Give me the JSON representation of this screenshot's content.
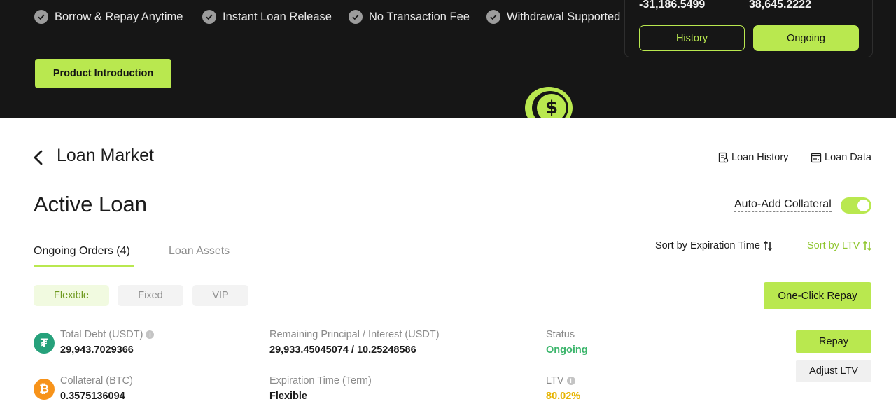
{
  "hero": {
    "features": [
      "Borrow & Repay Anytime",
      "Instant Loan Release",
      "No Transaction Fee",
      "Withdrawal Supported"
    ],
    "intro_button": "Product Introduction",
    "panel": {
      "value_left": "-31,186.5499",
      "value_right": "38,645.2222",
      "history_label": "History",
      "ongoing_label": "Ongoing"
    }
  },
  "header": {
    "title": "Loan Market",
    "loan_history": "Loan History",
    "loan_data": "Loan Data"
  },
  "main": {
    "title": "Active Loan",
    "auto_add_collateral": "Auto-Add Collateral",
    "auto_add_enabled": true,
    "tabs": [
      {
        "label": "Ongoing Orders (4)",
        "active": true
      },
      {
        "label": "Loan Assets",
        "active": false
      }
    ],
    "sort_expiration": "Sort by Expiration Time",
    "sort_ltv": "Sort by LTV",
    "filters": [
      {
        "label": "Flexible",
        "active": true
      },
      {
        "label": "Fixed",
        "active": false
      },
      {
        "label": "VIP",
        "active": false
      }
    ],
    "one_click_repay": "One-Click Repay"
  },
  "order": {
    "total_debt_label": "Total Debt (USDT)",
    "total_debt_value": "29,943.7029366",
    "remaining_label": "Remaining Principal / Interest (USDT)",
    "remaining_value": "29,933.45045074 / 10.25248586",
    "status_label": "Status",
    "status_value": "Ongoing",
    "collateral_label": "Collateral (BTC)",
    "collateral_value": "0.3575136094",
    "expiration_label": "Expiration Time (Term)",
    "expiration_value": "Flexible",
    "ltv_label": "LTV",
    "ltv_value": "80.02%",
    "repay_button": "Repay",
    "adjust_button": "Adjust LTV",
    "usdt_symbol": "₮",
    "btc_symbol": "₿"
  },
  "colors": {
    "accent": "#b9e84f",
    "status_green": "#3bb56b",
    "ltv_yellow": "#e6b400",
    "usdt": "#26a17b",
    "btc": "#f7931a"
  }
}
